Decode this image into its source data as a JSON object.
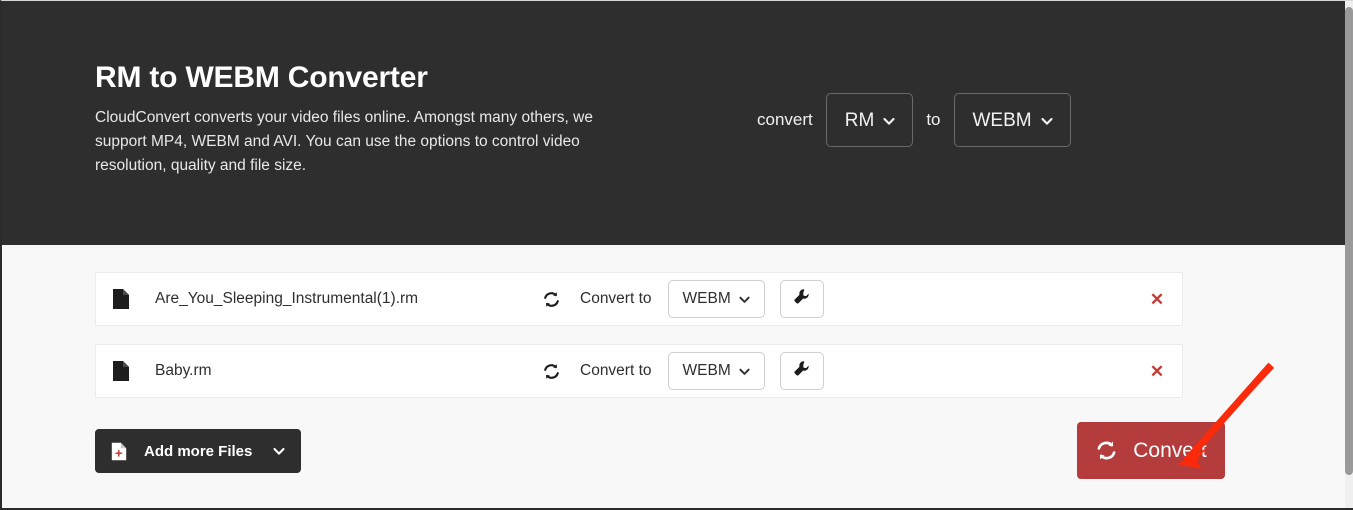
{
  "hero": {
    "title": "RM to WEBM Converter",
    "description": "CloudConvert converts your video files online. Amongst many others, we support MP4, WEBM and AVI. You can use the options to control video resolution, quality and file size.",
    "convert_label": "convert",
    "to_label": "to",
    "source_format": "RM",
    "target_format": "WEBM",
    "background_color": "#2e2e2e"
  },
  "files": [
    {
      "name": "Are_You_Sleeping_Instrumental(1).rm",
      "convert_to_label": "Convert to",
      "target_format": "WEBM",
      "remove_label": "✕"
    },
    {
      "name": "Baby.rm",
      "convert_to_label": "Convert to",
      "target_format": "WEBM",
      "remove_label": "✕"
    }
  ],
  "actions": {
    "add_more_files_label": "Add more Files",
    "convert_label": "Convert",
    "convert_button_color": "#b43c3c"
  },
  "annotation": {
    "arrow_color": "#fa2a0a"
  },
  "icons": {
    "file": "file-icon",
    "sync": "sync-icon",
    "wrench": "wrench-icon",
    "caret_down": "chevron-down-icon",
    "file_add": "file-add-icon",
    "close": "close-icon"
  }
}
